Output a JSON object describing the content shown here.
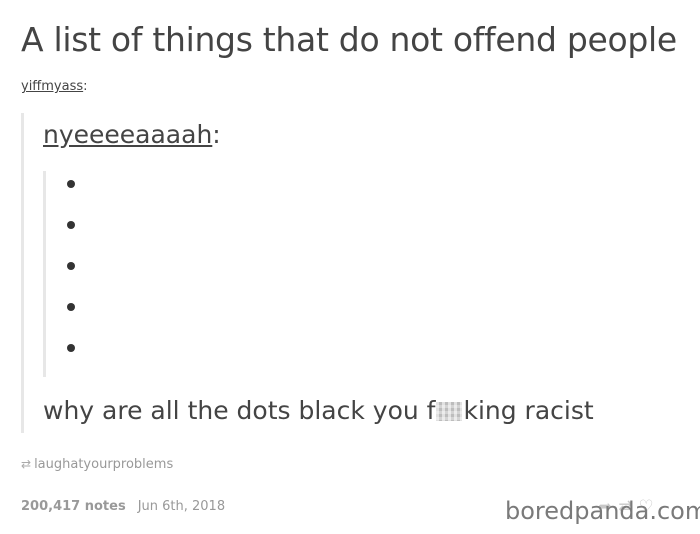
{
  "post": {
    "title": "A list of things that do not offend people",
    "reblogger": "yiffmyass",
    "quoted_user": "nyeeeeaaaah",
    "bullet_count": 5,
    "reply_before": "why are all the dots black you f",
    "reply_after": "king racist",
    "source": "laughatyourproblems",
    "notes": "200,417 notes",
    "date": "Jun 6th, 2018"
  },
  "colon": ":",
  "watermark": "boredpanda.com",
  "icons": {
    "source": "reblog-icon",
    "actions": [
      "share-icon",
      "reblog-icon",
      "heart-icon"
    ]
  }
}
